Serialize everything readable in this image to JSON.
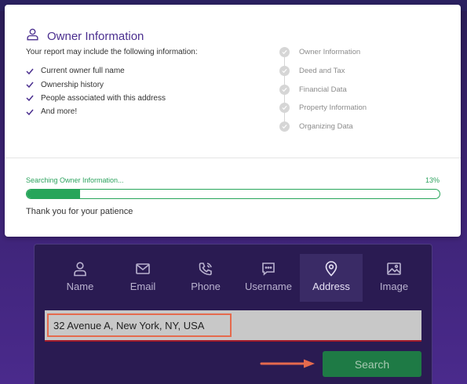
{
  "modal": {
    "title": "Owner Information",
    "intro": "Your report may include the following information:",
    "checklist": [
      "Current owner full name",
      "Ownership history",
      "People associated with this address",
      "And more!"
    ],
    "steps": [
      "Owner Information",
      "Deed and Tax",
      "Financial Data",
      "Property Information",
      "Organizing Data"
    ],
    "status_text": "Searching Owner Information...",
    "progress_percent_label": "13%",
    "progress_fraction": 0.13,
    "thanks": "Thank you for your patience"
  },
  "search_panel": {
    "tabs": [
      {
        "label": "Name",
        "icon": "person-icon"
      },
      {
        "label": "Email",
        "icon": "envelope-icon"
      },
      {
        "label": "Phone",
        "icon": "phone-icon"
      },
      {
        "label": "Username",
        "icon": "chat-icon"
      },
      {
        "label": "Address",
        "icon": "location-pin-icon"
      },
      {
        "label": "Image",
        "icon": "image-icon"
      }
    ],
    "active_tab": "Address",
    "address_value": "32 Avenue A, New York, NY, USA",
    "search_button": "Search"
  },
  "colors": {
    "accent_purple": "#4b2f8f",
    "progress_green": "#27a55a",
    "search_button": "#1e7a45",
    "highlight_box": "#e56a4d"
  }
}
